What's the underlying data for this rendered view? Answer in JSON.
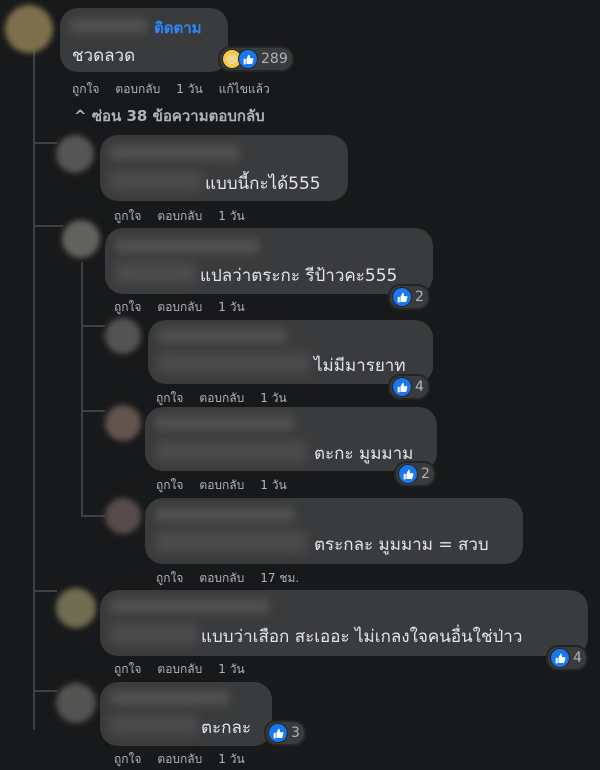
{
  "top_comment": {
    "follow_label": "ติดตาม",
    "text": "ชวดลวด",
    "reaction_count": "289",
    "actions": {
      "like": "ถูกใจ",
      "reply": "ตอบกลับ",
      "time": "1 วัน",
      "edited": "แก้ไขแล้ว"
    }
  },
  "hide_replies_label": "ซ่อน 38 ข้อความตอบกลับ",
  "replies": [
    {
      "text": "แบบนี้กะได้555",
      "like": "ถูกใจ",
      "reply": "ตอบกลับ",
      "time": "1 วัน",
      "count": ""
    },
    {
      "text": "แปลว่าตระกะ รีป้าวคะ555",
      "like": "ถูกใจ",
      "reply": "ตอบกลับ",
      "time": "1 วัน",
      "count": "2"
    },
    {
      "text": "ไม่มีมารยาท",
      "like": "ถูกใจ",
      "reply": "ตอบกลับ",
      "time": "1 วัน",
      "count": "4"
    },
    {
      "text": "ตะกะ มูมมาม",
      "like": "ถูกใจ",
      "reply": "ตอบกลับ",
      "time": "1 วัน",
      "count": "2"
    },
    {
      "text": "ตระกละ มูมมาม = สวบ",
      "like": "ถูกใจ",
      "reply": "ตอบกลับ",
      "time": "17 ชม.",
      "count": ""
    },
    {
      "text": "แบบว่าเสือก สะเออะ ไม่เกลงใจคนอื่นใช่ป่าว",
      "like": "ถูกใจ",
      "reply": "ตอบกลับ",
      "time": "1 วัน",
      "count": "4"
    },
    {
      "text": "ตะกละ",
      "like": "ถูกใจ",
      "reply": "ตอบกลับ",
      "time": "1 วัน",
      "count": "3"
    }
  ],
  "colors": {
    "background": "#18191a",
    "bubble": "#3a3b3c",
    "accent": "#2d88ff",
    "like": "#1877f2"
  }
}
